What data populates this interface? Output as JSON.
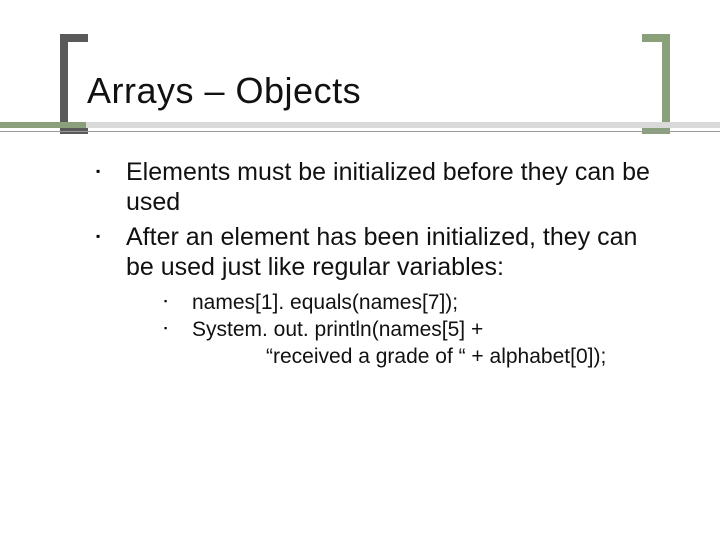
{
  "title": "Arrays – Objects",
  "bullets": [
    {
      "text": "Elements must be initialized before they can be used"
    },
    {
      "text": "After an element has been initialized, they can be used just like regular variables:",
      "sub": [
        {
          "line1": "names[1]. equals(names[7]);"
        },
        {
          "line1": "System. out. println(names[5] +",
          "line2": "“received a grade of “ + alphabet[0]);"
        }
      ]
    }
  ]
}
